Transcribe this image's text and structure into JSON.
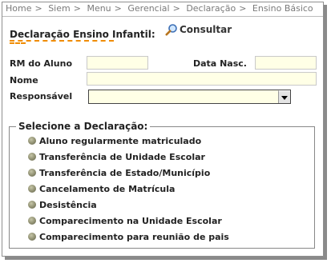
{
  "breadcrumb": [
    "Home",
    "Siem",
    "Menu",
    "Gerencial",
    "Declaração",
    "Ensino Básico"
  ],
  "page": {
    "title": "Declaração Ensino Infantil:",
    "consult_label": "Consultar",
    "accent_color": "#f08c00"
  },
  "form": {
    "rm_label": "RM do Aluno",
    "rm_value": "",
    "data_label": "Data Nasc.",
    "data_value": "",
    "nome_label": "Nome",
    "nome_value": "",
    "responsavel_label": "Responsável",
    "responsavel_value": ""
  },
  "declaracao": {
    "legend": "Selecione a Declaração:",
    "options": [
      "Aluno regularmente matriculado",
      "Transferência de Unidade Escolar",
      "Transferência de Estado/Município",
      "Cancelamento de Matrícula",
      "Desistência",
      "Comparecimento na Unidade Escolar",
      "Comparecimento para reunião de pais"
    ]
  }
}
